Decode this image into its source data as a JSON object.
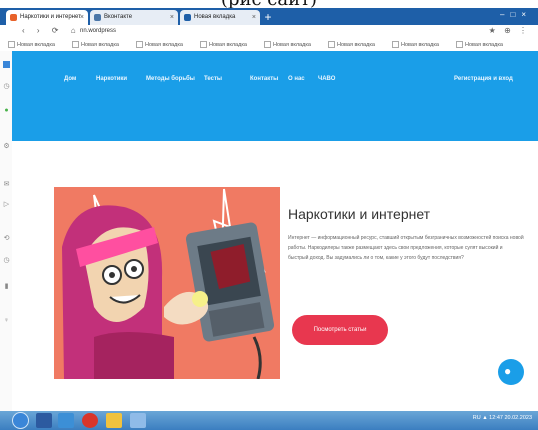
{
  "top_caption": "(рис сайт)",
  "browser": {
    "tabs": [
      {
        "label": "Наркотики и интернет"
      },
      {
        "label": "Вконтакте"
      },
      {
        "label": "Новая вкладка"
      }
    ],
    "url": "nn.wordpress",
    "bookmarks": [
      "Новая вкладка",
      "Новая вкладка",
      "Новая вкладка",
      "Новая вкладка",
      "Новая вкладка",
      "Новая вкладка",
      "Новая вкладка",
      "Новая вкладка"
    ]
  },
  "site": {
    "nav": [
      "Дом",
      "Наркотики",
      "Методы борьбы",
      "Тесты",
      "Контакты",
      "О нас",
      "ЧАВО"
    ],
    "nav_right": "Регистрация и вход",
    "heading": "Наркотики и интернет",
    "paragraph": "Интернет — информационный ресурс, ставший открытым безграничных возможностей поиска новой работы. Наркодилеры также размещают здесь свои предложения, которые сулят высокий и быстрый доход. Вы задумались ли о том, какие у этого будут последствия?",
    "cta": "Посмотреть статьи"
  },
  "taskbar": {
    "tray_text": "RU ▲ 12:47 20.02.2023"
  },
  "colors": {
    "header_blue": "#1a9ee8",
    "cta_red": "#e8374f",
    "illustration_bg": "#f07a63"
  }
}
